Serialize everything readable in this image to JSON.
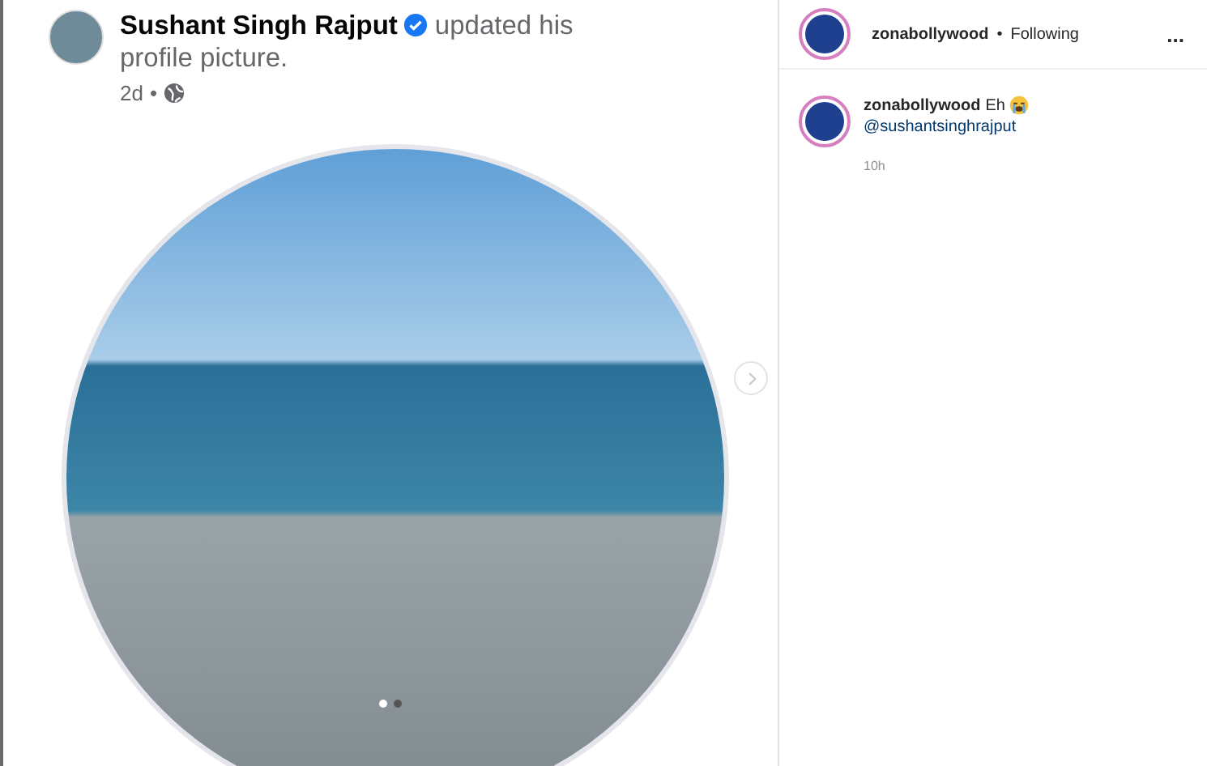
{
  "post": {
    "author": "Sushant Singh Rajput",
    "verified": true,
    "action_lines": [
      "updated his",
      "profile picture."
    ],
    "time": "2d",
    "separator": "•"
  },
  "carousel_dots": [
    {
      "selected": true
    },
    {
      "selected": false
    }
  ],
  "sidebar": {
    "header": {
      "username": "zonabollywood",
      "separator": "•",
      "follow_status": "Following",
      "more": "..."
    },
    "caption": {
      "username": "zonabollywood",
      "text": "Eh",
      "mention": "@sushantsinghrajput",
      "time": "10h"
    }
  }
}
